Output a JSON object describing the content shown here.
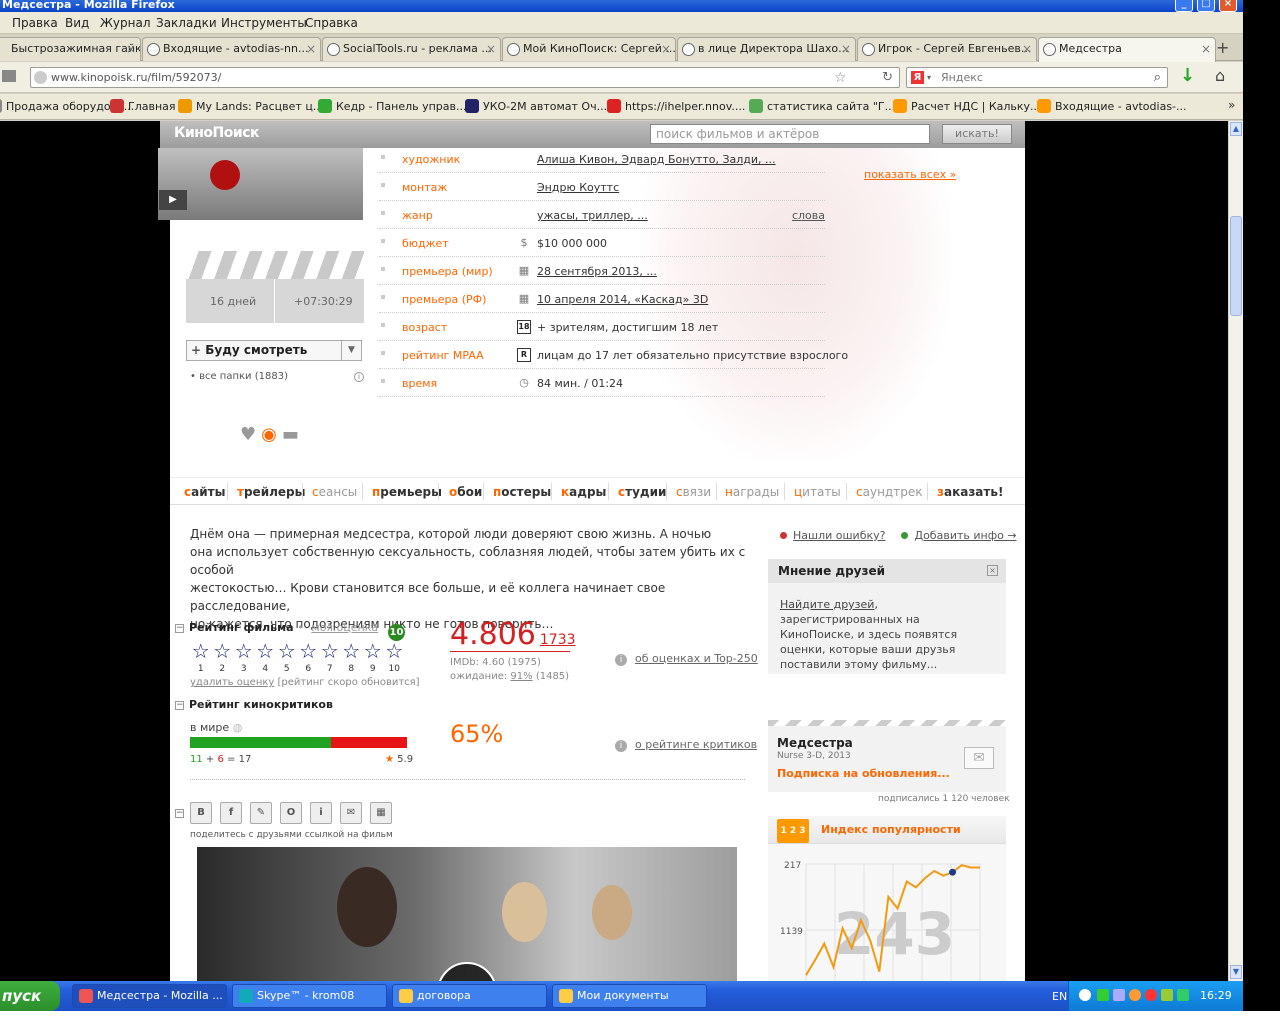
{
  "window": {
    "title": "Медсестра - Mozilla Firefox"
  },
  "menu": [
    "Правка",
    "Вид",
    "Журнал",
    "Закладки",
    "Инструменты",
    "Справка"
  ],
  "tabs": [
    {
      "label": "Быстрозажимная гайка ..."
    },
    {
      "label": "Входящие - avtodias-nn..."
    },
    {
      "label": "SocialTools.ru - реклама ..."
    },
    {
      "label": "Мой КиноПоиск: Сергей ..."
    },
    {
      "label": "в лице Директора Шахо..."
    },
    {
      "label": "Игрок - Сергей Евгеньев..."
    },
    {
      "label": "Медсестра"
    }
  ],
  "nav": {
    "url": "www.kinopoisk.ru/film/592073/",
    "search_placeholder": "Яндекс",
    "new_tab": "+"
  },
  "bookmarks": [
    {
      "label": "Продажа оборудова...",
      "color": "#888"
    },
    {
      "label": "Главная",
      "color": "#c33"
    },
    {
      "label": "My Lands: Расцвет ц...",
      "color": "#e90"
    },
    {
      "label": "Кедр - Панель управ...",
      "color": "#3a3"
    },
    {
      "label": "УКО-2М автомат Оч...",
      "color": "#226"
    },
    {
      "label": "https://ihelper.nnov....",
      "color": "#d22"
    },
    {
      "label": "статистика сайта \"Г...",
      "color": "#5a5"
    },
    {
      "label": "Расчет НДС | Кальку...",
      "color": "#f90"
    },
    {
      "label": "Входящие - avtodias-...",
      "color": "#f90"
    }
  ],
  "site": {
    "logo": "КиноПоиск",
    "search_placeholder": "поиск фильмов и актёров",
    "search_button": "искать!"
  },
  "countdown": {
    "days": "16 дней",
    "time": "+07:30:29"
  },
  "watch_button": "Буду смотреть",
  "folders": "все папки (1883)",
  "info_rows": [
    {
      "label": "художник",
      "icon": "",
      "value": "Алиша Кивон, Эдвард Бонутто, Залди, ...",
      "extra": ""
    },
    {
      "label": "монтаж",
      "icon": "",
      "value": "Эндрю Коуттс",
      "extra": ""
    },
    {
      "label": "жанр",
      "icon": "",
      "value": "ужасы, триллер, ...",
      "extra": "слова"
    },
    {
      "label": "бюджет",
      "icon": "$",
      "value": "$10 000 000",
      "extra": ""
    },
    {
      "label": "премьера (мир)",
      "icon": "▦",
      "value": "28 сентября 2013, ...",
      "extra": ""
    },
    {
      "label": "премьера (РФ)",
      "icon": "▦",
      "value": "10 апреля 2014, «Каскад»   3D",
      "extra": ""
    },
    {
      "label": "возраст",
      "icon": "18",
      "value": "+ зрителям, достигшим 18 лет",
      "extra": ""
    },
    {
      "label": "рейтинг MPAA",
      "icon": "R",
      "value": "лицам до 17 лет обязательно присутствие взрослого",
      "extra": ""
    },
    {
      "label": "время",
      "icon": "◷",
      "value": "84 мин. / 01:24",
      "extra": ""
    }
  ],
  "show_all": "показать всех »",
  "nav_strip": [
    {
      "label": "сайты",
      "grey": false
    },
    {
      "label": "трейлеры",
      "grey": false
    },
    {
      "label": "сеансы",
      "grey": true
    },
    {
      "label": "премьеры",
      "grey": false
    },
    {
      "label": "обои",
      "grey": false
    },
    {
      "label": "постеры",
      "grey": false
    },
    {
      "label": "кадры",
      "grey": false
    },
    {
      "label": "студии",
      "grey": false
    },
    {
      "label": "связи",
      "grey": true
    },
    {
      "label": "награды",
      "grey": true
    },
    {
      "label": "цитаты",
      "grey": true
    },
    {
      "label": "саундтрек",
      "grey": true
    },
    {
      "label": "заказать!",
      "grey": false
    }
  ],
  "description": [
    "Днём она — примерная медсестра, которой люди доверяют свою жизнь. А ночью",
    "она использует собственную сексуальность, соблазняя людей, чтобы затем убить их с особой",
    "жестокостью… Крови становится все больше, и её коллега начинает свое расследование,",
    "но кажется, что подозрениям никто не готов поверить…"
  ],
  "report": {
    "error": "Нашли ошибку?",
    "add": "Добавить инфо →"
  },
  "friends": {
    "title": "Мнение друзей",
    "link": "Найдите друзей",
    "text": ", зарегистрированных на КиноПоиске, и здесь появятся оценки, которые ваши друзья поставили этому фильму..."
  },
  "rating": {
    "title": "Рейтинг фильма",
    "my_label": "моя оценка",
    "my_value": "10",
    "stars": [
      "1",
      "2",
      "3",
      "4",
      "5",
      "6",
      "7",
      "8",
      "9",
      "10"
    ],
    "delete": "удалить оценку",
    "refresh": "[рейтинг скоро обновится]",
    "value": "4.806",
    "votes": "1733",
    "imdb": "IMDb: 4.60 (1975)",
    "expect_prefix": "ожидание: ",
    "expect_pct": "91%",
    "expect_count": " (1485)",
    "about": "об оценках и Top-250"
  },
  "critics": {
    "title": "Рейтинг кинокритиков",
    "world": "в мире",
    "positive": "11",
    "negative": "6",
    "total": "17",
    "positive_share": 0.65,
    "score": "5.9",
    "percent": "65%",
    "about": "о рейтинге критиков"
  },
  "share": {
    "buttons": [
      "В",
      "f",
      "✎",
      "О",
      "i",
      "✉",
      "▦"
    ],
    "caption": "поделитесь с друзьями ссылкой на фильм"
  },
  "subscribe": {
    "title": "Медсестра",
    "subtitle": "Nurse 3-D, 2013",
    "link": "Подписка на обновления...",
    "count": "подписались 1 120 человек"
  },
  "popularity": {
    "title": "Индекс популярности",
    "badge": "1 2 3",
    "big": "243",
    "chart_data": {
      "type": "line",
      "yticks": [
        "217",
        "1139"
      ],
      "values": [
        0.05,
        0.18,
        0.32,
        0.12,
        0.45,
        0.28,
        0.52,
        0.35,
        0.08,
        0.72,
        0.62,
        0.85,
        0.8,
        0.88,
        0.94,
        0.9,
        0.93,
        0.99,
        0.97,
        0.97
      ]
    }
  },
  "taskbar": {
    "start": "пуск",
    "tasks": [
      {
        "label": "Медсестра - Mozilla ...",
        "color": "#e55"
      },
      {
        "label": "Skype™ - krom08",
        "color": "#1ab"
      },
      {
        "label": "договора",
        "color": "#fc4"
      },
      {
        "label": "Мои документы",
        "color": "#fc4"
      }
    ],
    "lang": "EN",
    "clock": "16:29"
  }
}
